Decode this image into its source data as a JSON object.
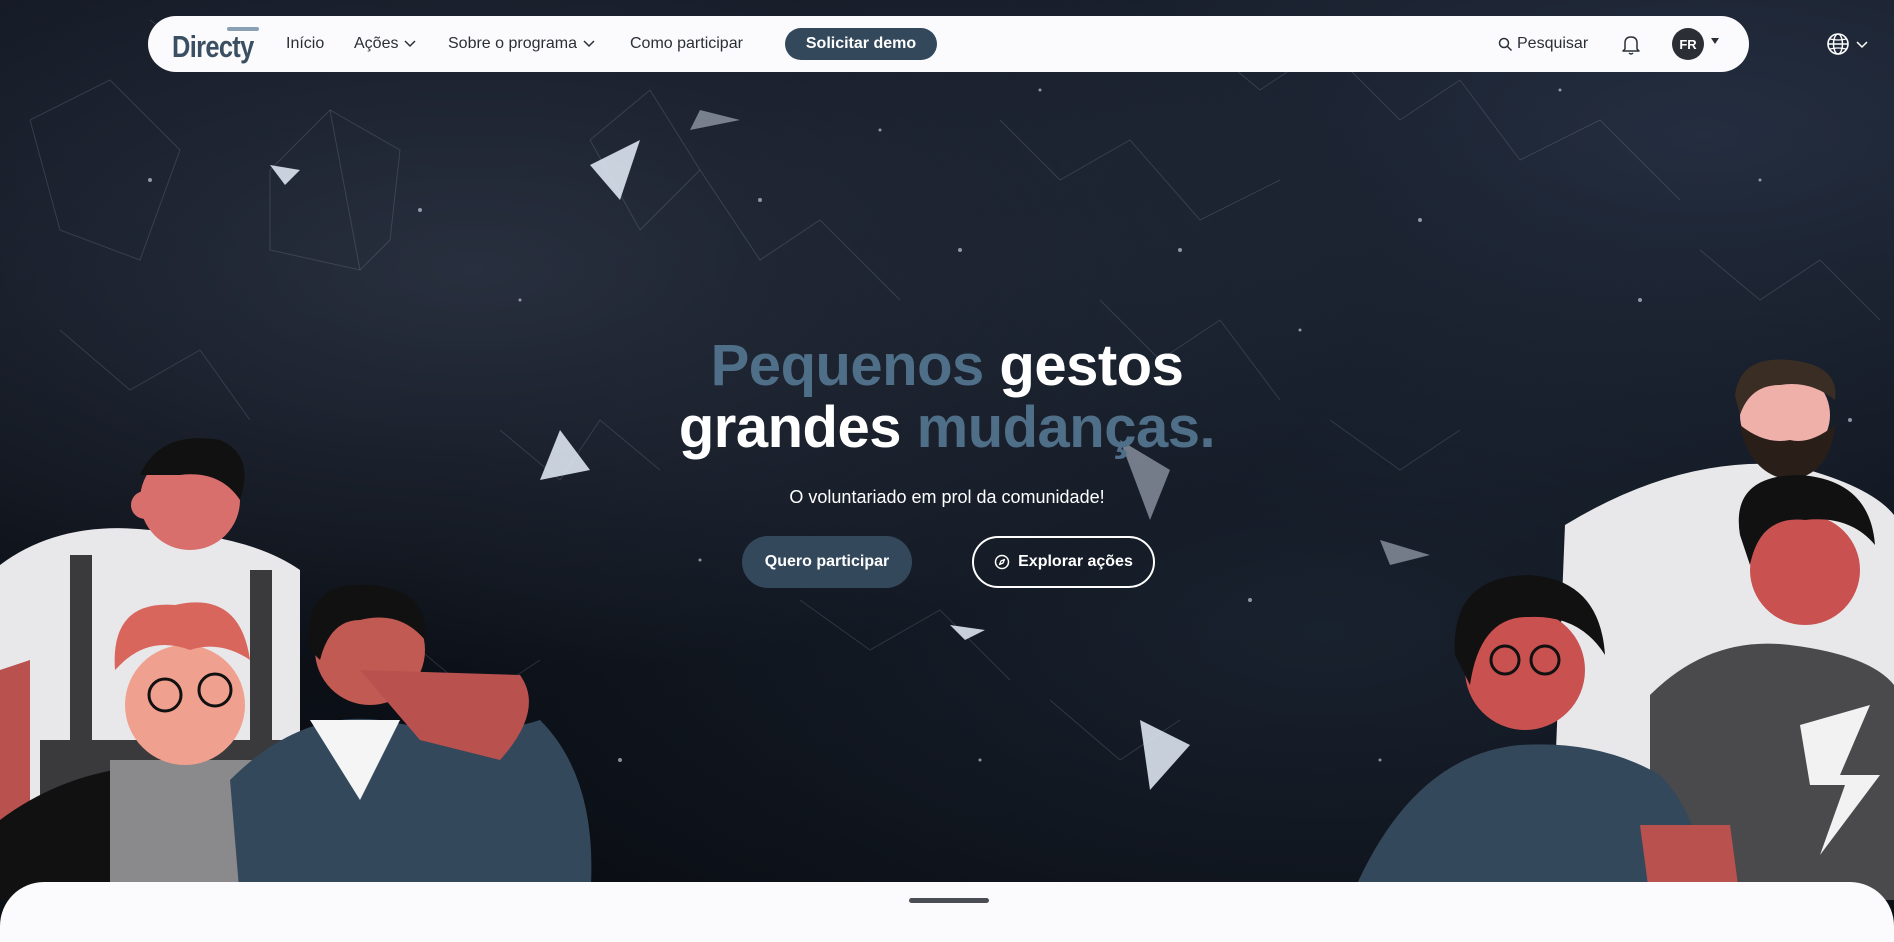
{
  "brand": {
    "logo_text": "Directy"
  },
  "nav": {
    "items": [
      {
        "label": "Início",
        "has_dropdown": false
      },
      {
        "label": "Ações",
        "has_dropdown": true
      },
      {
        "label": "Sobre o programa",
        "has_dropdown": true
      },
      {
        "label": "Como participar",
        "has_dropdown": false
      }
    ],
    "demo_button": "Solicitar demo",
    "search_label": "Pesquisar",
    "avatar_initials": "FR",
    "icons": [
      "search-icon",
      "bell-icon",
      "globe-icon",
      "chevron-down-icon"
    ]
  },
  "hero": {
    "headline_line1_accent": "Pequenos",
    "headline_line1_rest": "gestos",
    "headline_line2_start": "grandes",
    "headline_line2_accent": "mudanças.",
    "subtitle": "O voluntariado em prol da comunidade!",
    "primary_button": "Quero participar",
    "secondary_button": "Explorar ações",
    "secondary_button_icon": "compass-icon"
  },
  "colors": {
    "accent": "#4f6f88",
    "button_dark": "#34485c",
    "background": "#0b0f16",
    "navbar_bg": "#fbfbfd"
  }
}
